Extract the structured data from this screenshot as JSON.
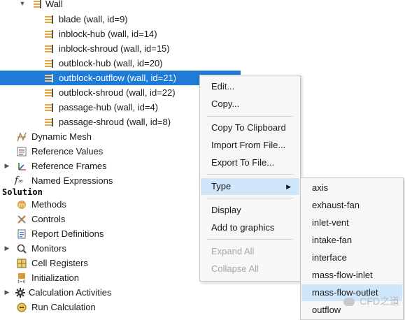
{
  "tree": {
    "wall_label": "Wall",
    "wall_children": [
      "blade (wall, id=9)",
      "inblock-hub (wall, id=14)",
      "inblock-shroud (wall, id=15)",
      "outblock-hub (wall, id=20)",
      "outblock-outflow (wall, id=21)",
      "outblock-shroud (wall, id=22)",
      "passage-hub (wall, id=4)",
      "passage-shroud (wall, id=8)"
    ],
    "setup_items": [
      "Dynamic Mesh",
      "Reference Values",
      "Reference Frames",
      "Named Expressions"
    ],
    "solution_header": "Solution",
    "solution_items": [
      "Methods",
      "Controls",
      "Report Definitions",
      "Monitors",
      "Cell Registers",
      "Initialization",
      "Calculation Activities",
      "Run Calculation"
    ]
  },
  "context_menu": {
    "items": [
      "Edit...",
      "Copy...",
      "Copy To Clipboard",
      "Import From File...",
      "Export To File...",
      "Type",
      "Display",
      "Add to graphics",
      "Expand All",
      "Collapse All"
    ]
  },
  "type_submenu": {
    "items": [
      "axis",
      "exhaust-fan",
      "inlet-vent",
      "intake-fan",
      "interface",
      "mass-flow-inlet",
      "mass-flow-outlet",
      "outflow"
    ]
  },
  "watermark": "CFD之道",
  "colors": {
    "selection": "#1f7bd6",
    "menu_highlight": "#cfe6fb",
    "disabled_text": "#a7a7a7"
  }
}
